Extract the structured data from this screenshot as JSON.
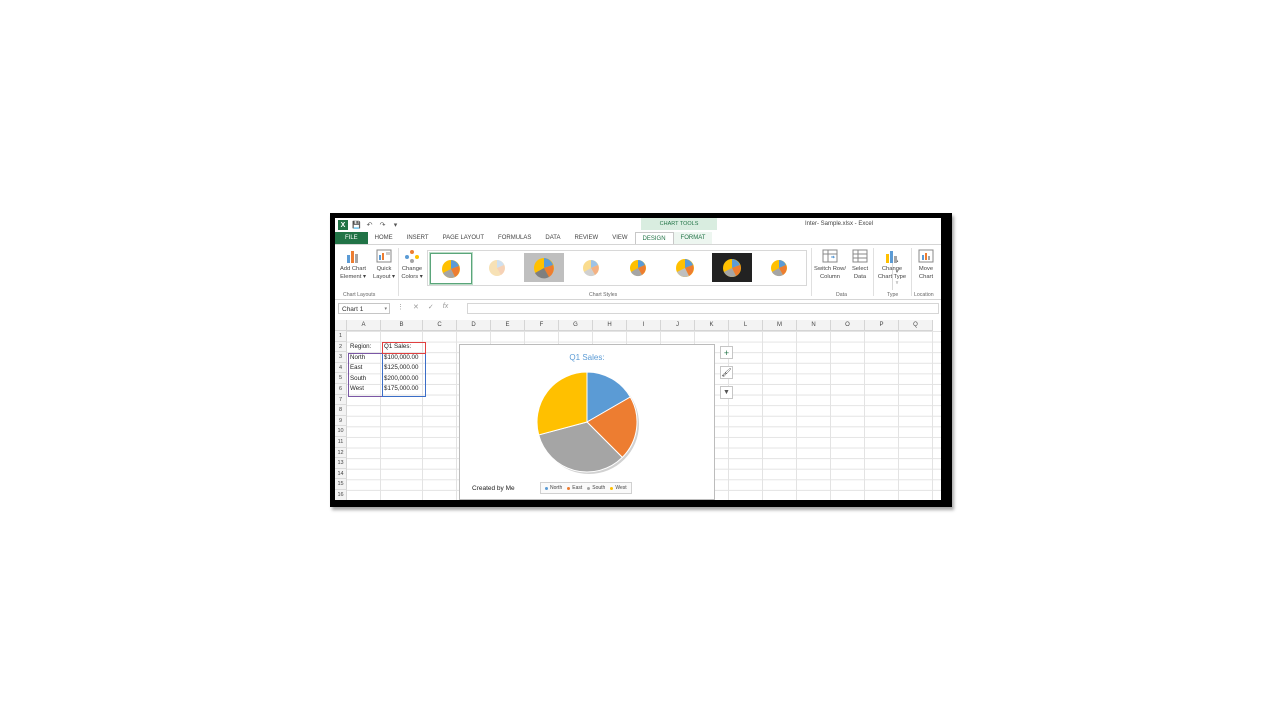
{
  "window": {
    "title": "Inter- Sample.xlsx - Excel",
    "context_header": "CHART TOOLS"
  },
  "quick_access": {
    "app_icon": "X",
    "save": "💾",
    "undo": "↶",
    "redo": "↷",
    "customize": "▾"
  },
  "tabs": [
    "FILE",
    "HOME",
    "INSERT",
    "PAGE LAYOUT",
    "FORMULAS",
    "DATA",
    "REVIEW",
    "VIEW",
    "DESIGN",
    "FORMAT"
  ],
  "ribbon": {
    "add_chart_element": [
      "Add Chart",
      "Element ▾"
    ],
    "quick_layout": [
      "Quick",
      "Layout ▾"
    ],
    "change_colors": [
      "Change",
      "Colors ▾"
    ],
    "switch_row_column": [
      "Switch Row/",
      "Column"
    ],
    "select_data": [
      "Select",
      "Data"
    ],
    "change_chart_type": [
      "Change",
      "Chart Type"
    ],
    "move_chart": [
      "Move",
      "Chart"
    ],
    "groups": {
      "layouts": "Chart Layouts",
      "styles": "Chart Styles",
      "data": "Data",
      "type": "Type",
      "location": "Location"
    }
  },
  "formula_bar": {
    "name_box": "Chart 1",
    "fx": "fx",
    "cancel": "✕",
    "enter": "✓",
    "value": ""
  },
  "columns": [
    "A",
    "B",
    "C",
    "D",
    "E",
    "F",
    "G",
    "H",
    "I",
    "J",
    "K",
    "L",
    "M",
    "N",
    "O",
    "P",
    "Q"
  ],
  "rows": [
    "1",
    "2",
    "3",
    "4",
    "5",
    "6",
    "7",
    "8",
    "9",
    "10",
    "11",
    "12",
    "13",
    "14",
    "15",
    "16"
  ],
  "cells": {
    "A2": "Region:",
    "B2": "Q1 Sales:",
    "A3": "North",
    "B3": "$100,000.00",
    "A4": "East",
    "B4": "$125,000.00",
    "A5": "South",
    "B5": "$200,000.00",
    "A6": "West",
    "B6": "$175,000.00"
  },
  "chart_data": {
    "type": "pie",
    "title": "Q1 Sales:",
    "categories": [
      "North",
      "East",
      "South",
      "West"
    ],
    "values": [
      100000,
      125000,
      200000,
      175000
    ],
    "colors": [
      "#5b9bd5",
      "#ed7d31",
      "#a5a5a5",
      "#ffc000"
    ],
    "legend_position": "bottom"
  },
  "chart_credit": "Created by Me",
  "chart_side_buttons": {
    "elements": "+",
    "styles": "🖌",
    "filters": "▼"
  },
  "accent_color": "#217346"
}
